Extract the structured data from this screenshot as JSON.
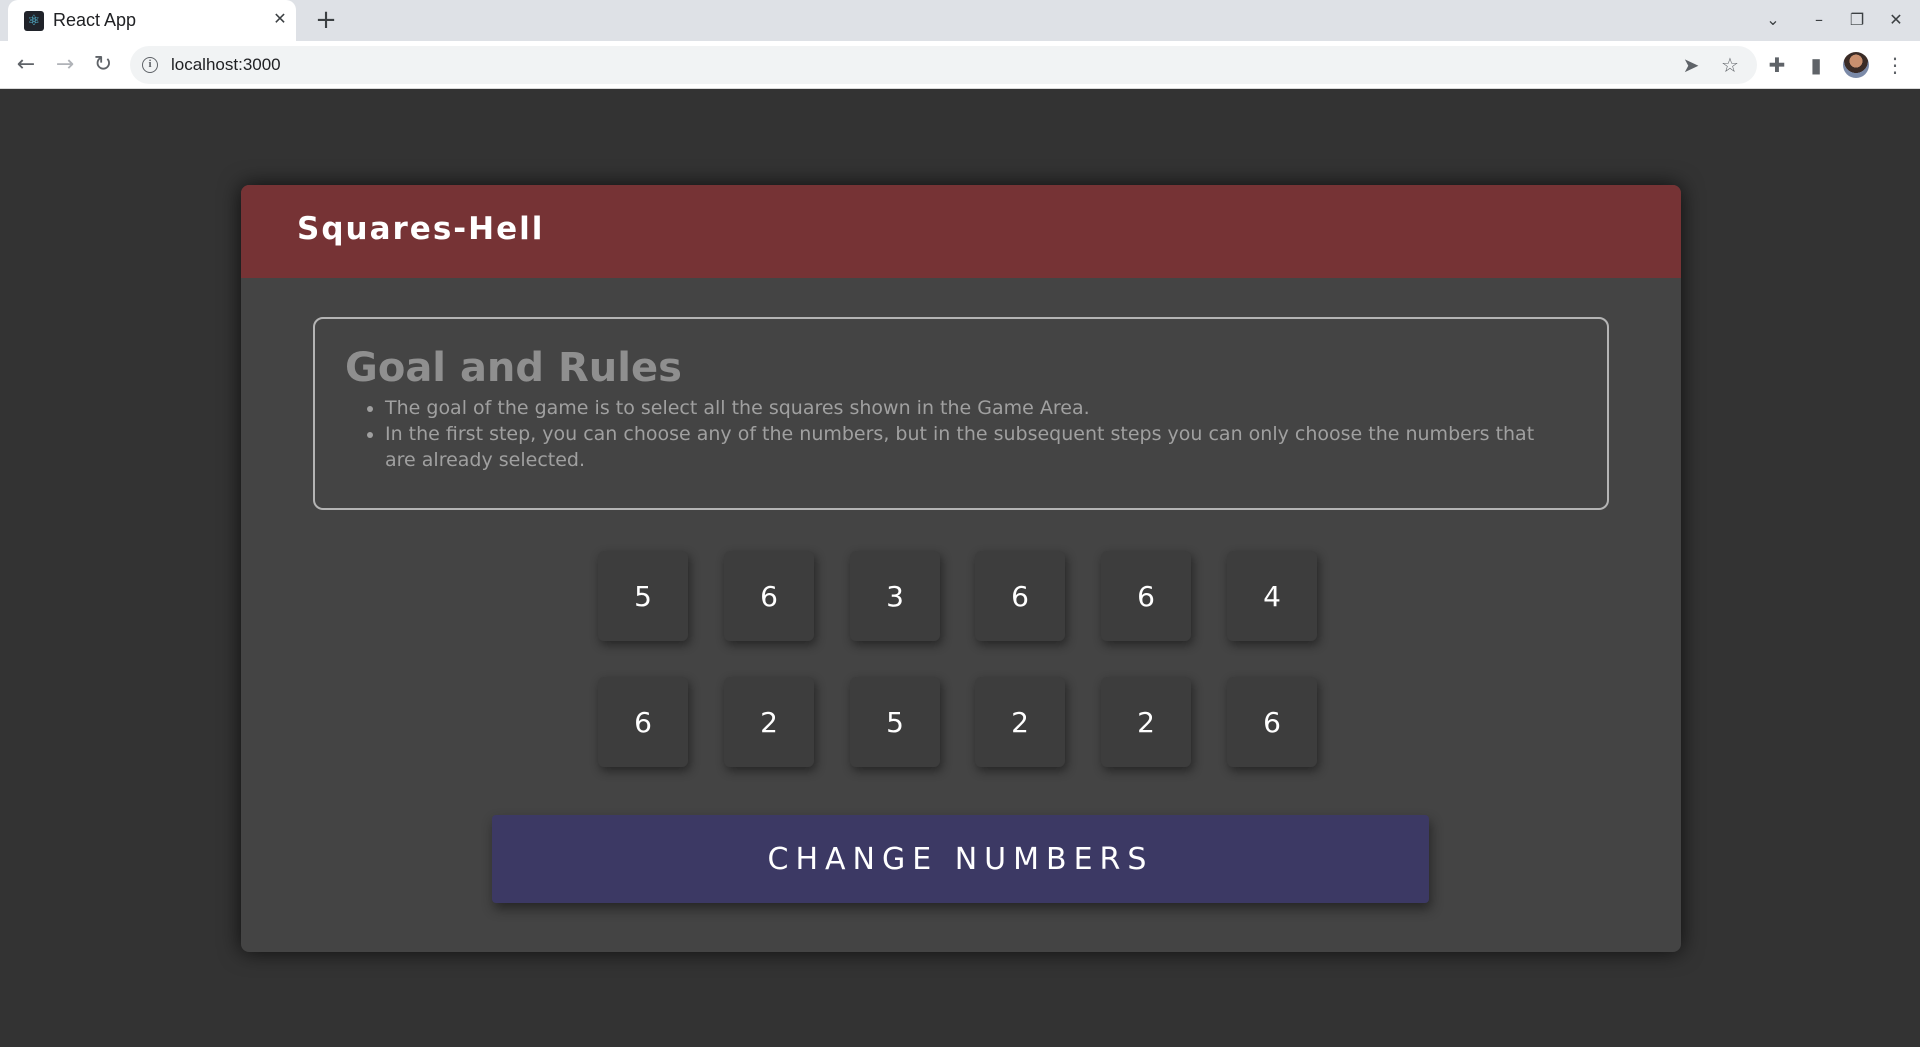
{
  "browser": {
    "tab_title": "React App",
    "tab_close": "✕",
    "new_tab": "+",
    "url": "localhost:3000",
    "icons": {
      "back": "←",
      "forward": "→",
      "reload": "↻",
      "send": "➤",
      "star": "☆",
      "extensions": "✚",
      "side_panel": "▮",
      "menu": "⋮",
      "tab_search": "⌄",
      "minimize": "–",
      "restore": "❐",
      "close": "✕"
    }
  },
  "app": {
    "title": "Squares-Hell",
    "rules": {
      "heading": "Goal and Rules",
      "items": [
        "The goal of the game is to select all the squares shown in the Game Area.",
        "In the first step, you can choose any of the numbers, but in the subsequent steps you can only choose the numbers that are already selected."
      ]
    },
    "squares": [
      [
        "5",
        "6",
        "3",
        "6",
        "6",
        "4"
      ],
      [
        "6",
        "2",
        "5",
        "2",
        "2",
        "6"
      ]
    ],
    "change_button_label": "CHANGE NUMBERS",
    "colors": {
      "background": "#333333",
      "card": "#444444",
      "header": "#763335",
      "square": "#3d3d3d",
      "button": "#3c3964"
    }
  }
}
